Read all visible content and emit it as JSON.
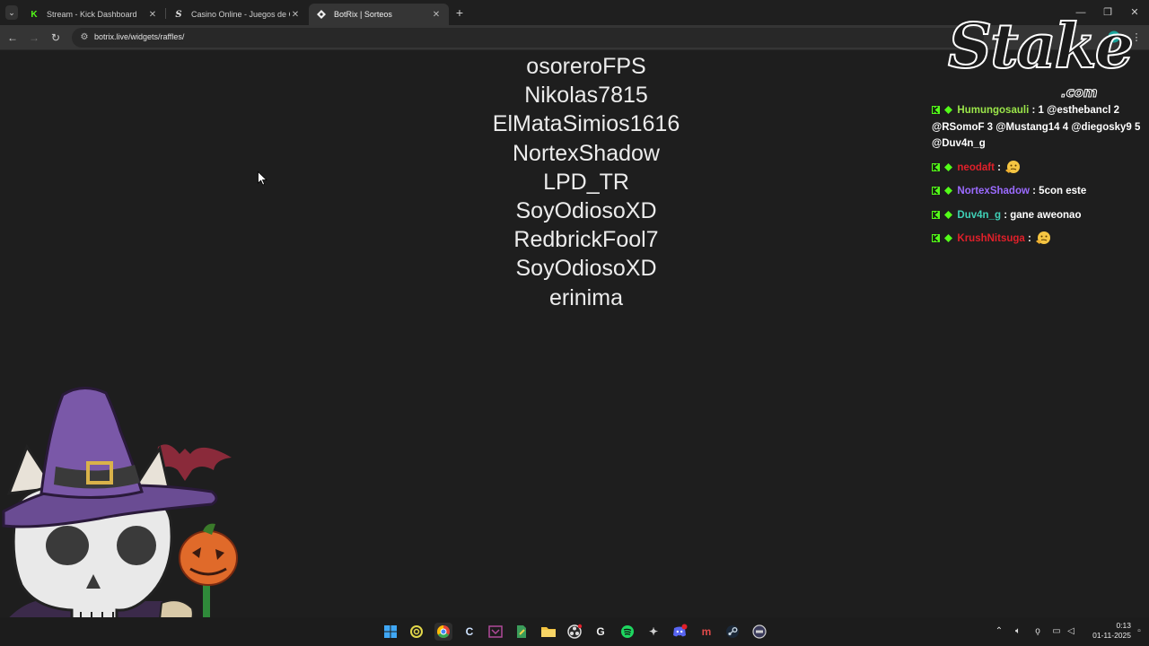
{
  "browser": {
    "tabs": [
      {
        "label": "Stream - Kick Dashboard",
        "favicon": "kick-icon",
        "active": false
      },
      {
        "label": "Casino Online - Juegos de Casino",
        "favicon": "stake-s-icon",
        "active": false
      },
      {
        "label": "BotRix | Sorteos",
        "favicon": "botrix-icon",
        "active": true
      }
    ],
    "new_tab_symbol": "+",
    "url": "botrix.live/widgets/raffles/"
  },
  "raffle": {
    "entries": [
      "osoreroFPS",
      "Nikolas7815",
      "ElMataSimios1616",
      "NortexShadow",
      "LPD_TR",
      "SoyOdiosoXD",
      "RedbrickFool7",
      "SoyOdiosoXD",
      "erinima"
    ]
  },
  "overlay": {
    "logo_text": "Stake",
    "logo_suffix": ".com"
  },
  "chat": {
    "messages": [
      {
        "user": "Humungosauli",
        "user_color": "#9be64a",
        "text": "1 @esthebancl 2 @RSomoF 3 @Mustang14 4 @diegosky9 5 @Duv4n_g",
        "emote": null
      },
      {
        "user": "neodaft",
        "user_color": "#e0202a",
        "text": "",
        "emote": "thinking-face-emote"
      },
      {
        "user": "NortexShadow",
        "user_color": "#9b6bff",
        "text": "5con este",
        "emote": null
      },
      {
        "user": "Duv4n_g",
        "user_color": "#3fd0b6",
        "text": "gane aweonao",
        "emote": null
      },
      {
        "user": "KrushNitsuga",
        "user_color": "#e0202a",
        "text": "",
        "emote": "thinking-face-emote"
      }
    ],
    "separator": ":"
  },
  "taskbar": {
    "clock_time": "0:13",
    "clock_date": "01-11-2025"
  },
  "colors": {
    "page_background": "#1e1e1e",
    "kick_green": "#53fc18",
    "chrome_tabstrip": "#1f1f1f",
    "chrome_toolbar": "#353535"
  }
}
